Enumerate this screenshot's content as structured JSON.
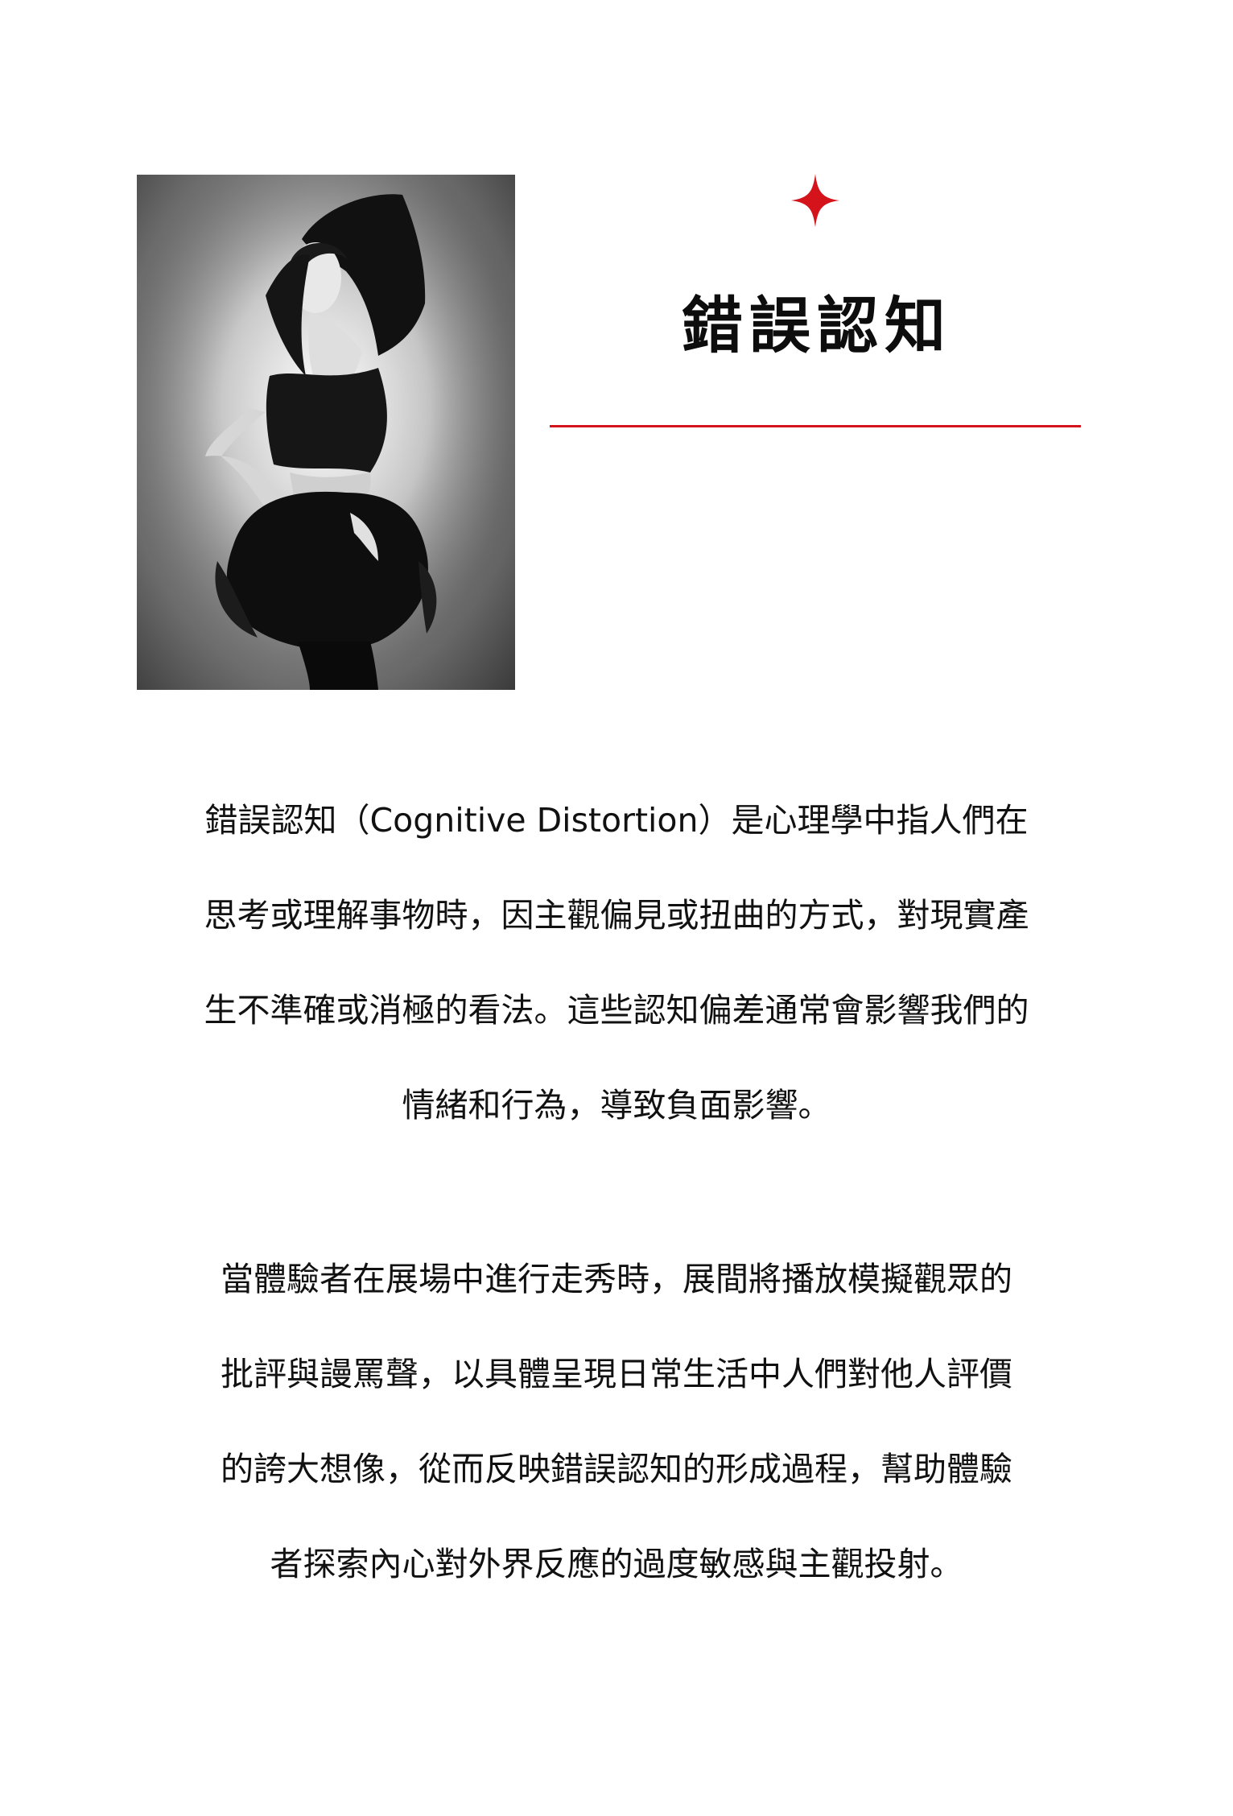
{
  "hero": {
    "image_alt": "black-and-white fashion photo of a model in a dark sculptural garment",
    "accent_color": "#d4131b"
  },
  "heading": {
    "title": "錯誤認知"
  },
  "body": {
    "paragraph1": [
      "錯誤認知（Cognitive Distortion）是心理學中指人們在",
      "思考或理解事物時，因主觀偏見或扭曲的方式，對現實產",
      "生不準確或消極的看法。這些認知偏差通常會影響我們的",
      "情緒和行為，導致負面影響。"
    ],
    "paragraph2": [
      "當體驗者在展場中進行走秀時，展間將播放模擬觀眾的",
      "批評與謾罵聲，以具體呈現日常生活中人們對他人評價",
      "的誇大想像，從而反映錯誤認知的形成過程，幫助體驗",
      "者探索內心對外界反應的過度敏感與主觀投射。"
    ]
  }
}
